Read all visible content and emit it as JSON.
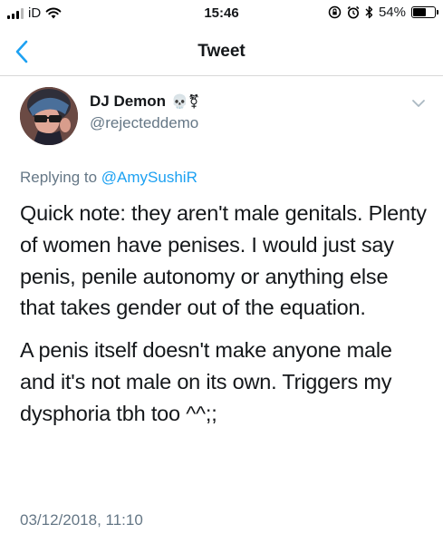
{
  "status_bar": {
    "carrier": "iD",
    "time": "15:46",
    "battery_percent": "54%",
    "icons": [
      "signal-icon",
      "wifi-icon",
      "orientation-lock-icon",
      "alarm-icon",
      "bluetooth-icon",
      "battery-icon"
    ],
    "battery_level": 0.54
  },
  "nav": {
    "title": "Tweet",
    "back_icon": "chevron-left-icon",
    "accent_color": "#1da1f2"
  },
  "tweet": {
    "author": {
      "display_name": "DJ Demon",
      "name_emoji": "💀⚧",
      "handle": "@rejecteddemo"
    },
    "reply": {
      "prefix": "Replying to ",
      "mention": "@AmySushiR"
    },
    "paragraphs": [
      "Quick note: they aren't male genitals. Plenty of women have penises. I would just say penis, penile autonomy or anything else that takes gender out of the equation.",
      "A penis itself doesn't make anyone male and it's not male on its own. Triggers my dysphoria tbh too ^^;;"
    ],
    "timestamp": "03/12/2018, 11:10"
  },
  "colors": {
    "text": "#14171a",
    "secondary": "#657786",
    "link": "#1da1f2",
    "divider": "#d8d8d8"
  }
}
